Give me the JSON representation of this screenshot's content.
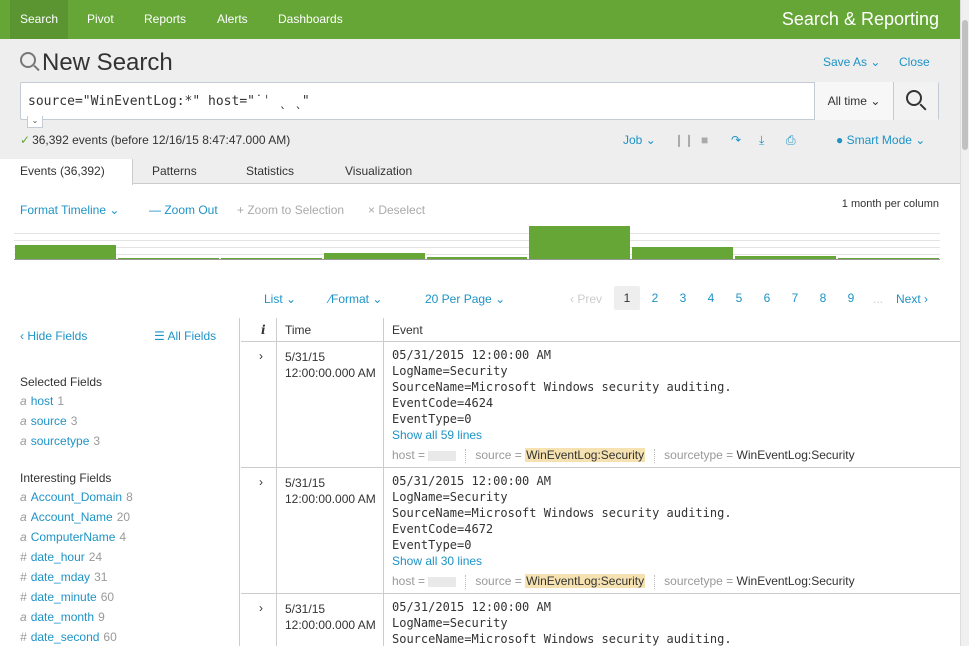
{
  "nav": {
    "tabs": [
      "Search",
      "Pivot",
      "Reports",
      "Alerts",
      "Dashboards"
    ],
    "app_title": "Search & Reporting"
  },
  "header": {
    "title": "New Search",
    "save_as": "Save As",
    "close": "Close"
  },
  "search": {
    "query": "source=\"WinEventLog:*\" host=\"˙ˈ ˎ ˎ\"",
    "time_range": "All time"
  },
  "status": {
    "text": "36,392 events (before 12/16/15 8:47:47.000 AM)",
    "job": "Job",
    "mode": "Smart Mode"
  },
  "tabs": [
    "Events (36,392)",
    "Patterns",
    "Statistics",
    "Visualization"
  ],
  "timeline": {
    "format": "Format Timeline",
    "zoom_out": "— Zoom Out",
    "zoom_sel": "+ Zoom to Selection",
    "deselect": "× Deselect",
    "scale": "1 month per column"
  },
  "chart_data": {
    "type": "bar",
    "values": [
      14,
      1,
      1,
      6,
      2,
      33,
      12,
      3,
      1
    ],
    "ylim": [
      0,
      34
    ]
  },
  "pager": {
    "list": "List",
    "format": "Format",
    "per_page": "20 Per Page",
    "prev": "‹ Prev",
    "pages": [
      "1",
      "2",
      "3",
      "4",
      "5",
      "6",
      "7",
      "8",
      "9"
    ],
    "ellipsis": "...",
    "next": "Next ›"
  },
  "sidebar": {
    "hide": "‹ Hide Fields",
    "all": "All Fields",
    "selected_title": "Selected Fields",
    "selected": [
      {
        "type": "a",
        "name": "host",
        "count": "1"
      },
      {
        "type": "a",
        "name": "source",
        "count": "3"
      },
      {
        "type": "a",
        "name": "sourcetype",
        "count": "3"
      }
    ],
    "interesting_title": "Interesting Fields",
    "interesting": [
      {
        "type": "a",
        "name": "Account_Domain",
        "count": "8"
      },
      {
        "type": "a",
        "name": "Account_Name",
        "count": "20"
      },
      {
        "type": "a",
        "name": "ComputerName",
        "count": "4"
      },
      {
        "type": "#",
        "name": "date_hour",
        "count": "24"
      },
      {
        "type": "#",
        "name": "date_mday",
        "count": "31"
      },
      {
        "type": "#",
        "name": "date_minute",
        "count": "60"
      },
      {
        "type": "a",
        "name": "date_month",
        "count": "9"
      },
      {
        "type": "#",
        "name": "date_second",
        "count": "60"
      }
    ]
  },
  "table": {
    "col_i": "i",
    "col_time": "Time",
    "col_event": "Event"
  },
  "events": [
    {
      "date": "5/31/15",
      "time": "12:00:00.000 AM",
      "lines": [
        "05/31/2015 12:00:00 AM",
        "LogName=Security",
        "SourceName=Microsoft Windows security auditing.",
        "EventCode=4624",
        "EventType=0"
      ],
      "show_all": "Show all 59 lines",
      "host_label": "host =",
      "source_label": "source =",
      "source": "WinEventLog:Security",
      "sourcetype_label": "sourcetype =",
      "sourcetype": "WinEventLog:Security"
    },
    {
      "date": "5/31/15",
      "time": "12:00:00.000 AM",
      "lines": [
        "05/31/2015 12:00:00 AM",
        "LogName=Security",
        "SourceName=Microsoft Windows security auditing.",
        "EventCode=4672",
        "EventType=0"
      ],
      "show_all": "Show all 30 lines",
      "host_label": "host =",
      "source_label": "source =",
      "source": "WinEventLog:Security",
      "sourcetype_label": "sourcetype =",
      "sourcetype": "WinEventLog:Security"
    },
    {
      "date": "5/31/15",
      "time": "12:00:00.000 AM",
      "lines": [
        "05/31/2015 12:00:00 AM",
        "LogName=Security",
        "SourceName=Microsoft Windows security auditing."
      ]
    }
  ]
}
